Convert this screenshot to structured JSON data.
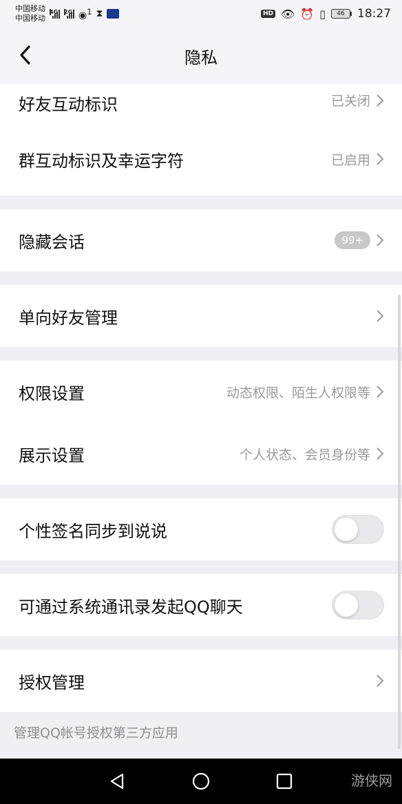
{
  "status_bar": {
    "carrier1": "中国移动",
    "carrier2": "中国移动",
    "net1": "4G",
    "net2": "2G",
    "hotspot_count": "1",
    "hd": "HD",
    "battery": "46",
    "time": "18:27"
  },
  "nav": {
    "title": "隐私"
  },
  "rows": {
    "friend_interaction": {
      "label": "好友互动标识",
      "value": "已关闭"
    },
    "group_interaction": {
      "label": "群互动标识及幸运字符",
      "value": "已启用"
    },
    "hidden_chats": {
      "label": "隐藏会话",
      "badge": "99+"
    },
    "one_way_friends": {
      "label": "单向好友管理"
    },
    "permissions": {
      "label": "权限设置",
      "value": "动态权限、陌生人权限等"
    },
    "display": {
      "label": "展示设置",
      "value": "个人状态、会员身份等"
    },
    "sync_signature": {
      "label": "个性签名同步到说说",
      "toggle": false
    },
    "contacts_chat": {
      "label": "可通过系统通讯录发起QQ聊天",
      "toggle": false
    },
    "authorization": {
      "label": "授权管理"
    }
  },
  "footnote": "管理QQ帐号授权第三方应用",
  "watermark": "游侠网",
  "icons": {
    "back": "back-chevron-icon",
    "chevron": "chevron-right-icon",
    "sys_back": "triangle-back-icon",
    "sys_home": "circle-home-icon",
    "sys_recent": "square-recent-icon"
  }
}
